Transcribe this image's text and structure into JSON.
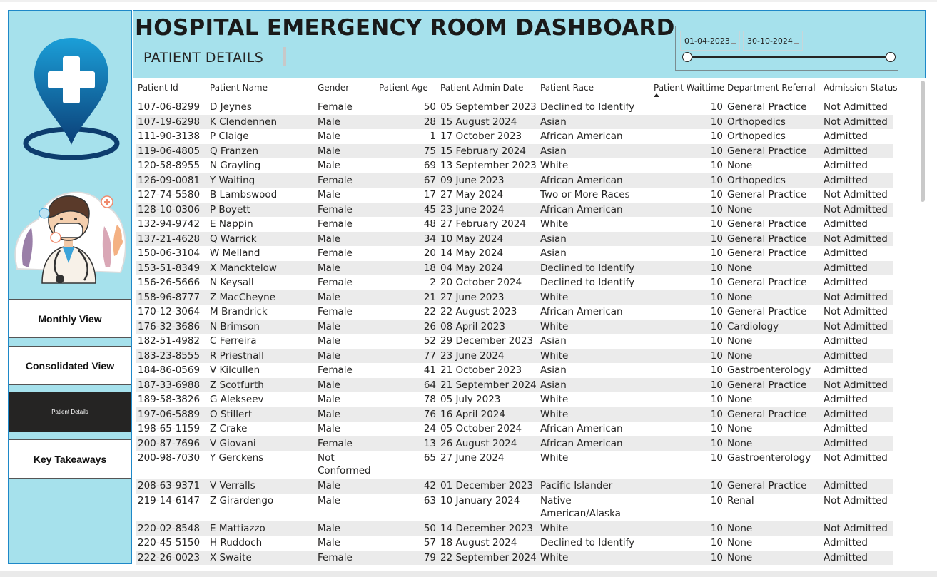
{
  "header": {
    "title": "HOSPITAL EMERGENCY ROOM DASHBOARD",
    "subtitle": "PATIENT DETAILS"
  },
  "date_slicer": {
    "start": "01-04-2023",
    "end": "30-10-2024"
  },
  "nav": {
    "monthly": "Monthly View",
    "consolidated": "Consolidated View",
    "patient_details": "Patient Details",
    "key_takeaways": "Key Takeaways"
  },
  "icons": {
    "location": "hospital-location-pin-icon",
    "doctor": "doctor-illustration-icon",
    "calendar": "calendar-icon"
  },
  "colors": {
    "panel": "#a6e1ec",
    "accent": "#1e88c8",
    "active_nav": "#252423"
  },
  "table": {
    "columns": [
      "Patient Id",
      "Patient Name",
      "Gender",
      "Patient Age",
      "Patient Admin Date",
      "Patient Race",
      "Patient Waittime",
      "Department Referral",
      "Admission Status"
    ],
    "sorted_column": "Patient Waittime",
    "rows": [
      [
        "107-06-8299",
        "D Jeynes",
        "Female",
        "50",
        "05 September 2023",
        "Declined to Identify",
        "10",
        "General Practice",
        "Not Admitted"
      ],
      [
        "107-19-6298",
        "K Clendennen",
        "Male",
        "28",
        "15 August 2024",
        "Asian",
        "10",
        "Orthopedics",
        "Not Admitted"
      ],
      [
        "111-90-3138",
        "P Claige",
        "Male",
        "1",
        "17 October 2023",
        "African American",
        "10",
        "Orthopedics",
        "Admitted"
      ],
      [
        "119-06-4805",
        "Q Franzen",
        "Male",
        "75",
        "15 February 2024",
        "Asian",
        "10",
        "General Practice",
        "Admitted"
      ],
      [
        "120-58-8955",
        "N Grayling",
        "Male",
        "69",
        "13 September 2023",
        "White",
        "10",
        "None",
        "Admitted"
      ],
      [
        "126-09-0081",
        "Y Waiting",
        "Female",
        "67",
        "09 June 2023",
        "African American",
        "10",
        "Orthopedics",
        "Admitted"
      ],
      [
        "127-74-5580",
        "B Lambswood",
        "Male",
        "17",
        "27 May 2024",
        "Two or More Races",
        "10",
        "General Practice",
        "Not Admitted"
      ],
      [
        "128-10-0306",
        "P Boyett",
        "Female",
        "45",
        "23 June 2024",
        "African American",
        "10",
        "None",
        "Not Admitted"
      ],
      [
        "132-94-9742",
        "E Nappin",
        "Female",
        "48",
        "27 February 2024",
        "White",
        "10",
        "General Practice",
        "Admitted"
      ],
      [
        "137-21-4628",
        "Q Warrick",
        "Male",
        "34",
        "10 May 2024",
        "Asian",
        "10",
        "General Practice",
        "Not Admitted"
      ],
      [
        "150-06-3104",
        "W Melland",
        "Female",
        "20",
        "14 May 2024",
        "Asian",
        "10",
        "General Practice",
        "Admitted"
      ],
      [
        "153-51-8349",
        "X Mancktelow",
        "Male",
        "18",
        "04 May 2024",
        "Declined to Identify",
        "10",
        "None",
        "Admitted"
      ],
      [
        "156-26-5666",
        "N Keysall",
        "Female",
        "2",
        "20 October 2024",
        "Declined to Identify",
        "10",
        "General Practice",
        "Admitted"
      ],
      [
        "158-96-8777",
        "Z MacCheyne",
        "Male",
        "21",
        "27 June 2023",
        "White",
        "10",
        "None",
        "Not Admitted"
      ],
      [
        "170-12-3064",
        "M Brandrick",
        "Female",
        "22",
        "22 August 2023",
        "African American",
        "10",
        "General Practice",
        "Not Admitted"
      ],
      [
        "176-32-3686",
        "N Brimson",
        "Male",
        "26",
        "08 April 2023",
        "White",
        "10",
        "Cardiology",
        "Not Admitted"
      ],
      [
        "182-51-4982",
        "C Ferreira",
        "Male",
        "52",
        "29 December 2023",
        "Asian",
        "10",
        "None",
        "Admitted"
      ],
      [
        "183-23-8555",
        "R Priestnall",
        "Male",
        "77",
        "23 June 2024",
        "White",
        "10",
        "None",
        "Admitted"
      ],
      [
        "184-86-0569",
        "V Kilcullen",
        "Female",
        "41",
        "21 October 2023",
        "Asian",
        "10",
        "Gastroenterology",
        "Admitted"
      ],
      [
        "187-33-6988",
        "Z Scotfurth",
        "Male",
        "64",
        "21 September 2024",
        "Asian",
        "10",
        "General Practice",
        "Not Admitted"
      ],
      [
        "189-58-3826",
        "G Alekseev",
        "Male",
        "78",
        "05 July 2023",
        "White",
        "10",
        "None",
        "Admitted"
      ],
      [
        "197-06-5889",
        "O Stillert",
        "Male",
        "76",
        "16 April 2024",
        "White",
        "10",
        "General Practice",
        "Admitted"
      ],
      [
        "198-65-1159",
        "Z Crake",
        "Male",
        "24",
        "05 October 2024",
        "African American",
        "10",
        "None",
        "Admitted"
      ],
      [
        "200-87-7696",
        "V Giovani",
        "Female",
        "13",
        "26 August 2024",
        "African American",
        "10",
        "None",
        "Admitted"
      ],
      [
        "200-98-7030",
        "Y Gerckens",
        "Not Conformed",
        "65",
        "27 June 2024",
        "White",
        "10",
        "Gastroenterology",
        "Not Admitted"
      ],
      [
        "208-63-9371",
        "V Verralls",
        "Male",
        "42",
        "01 December 2023",
        "Pacific Islander",
        "10",
        "General Practice",
        "Admitted"
      ],
      [
        "219-14-6147",
        "Z Girardengo",
        "Male",
        "63",
        "10 January 2024",
        "Native American/Alaska Native",
        "10",
        "Renal",
        "Not Admitted"
      ],
      [
        "220-02-8548",
        "E Mattiazzo",
        "Male",
        "50",
        "14 December 2023",
        "White",
        "10",
        "None",
        "Not Admitted"
      ],
      [
        "220-45-5150",
        "H Ruddoch",
        "Male",
        "57",
        "18 August 2024",
        "Declined to Identify",
        "10",
        "None",
        "Admitted"
      ],
      [
        "222-26-0023",
        "X Swaite",
        "Female",
        "79",
        "22 September 2024",
        "White",
        "10",
        "None",
        "Admitted"
      ]
    ]
  }
}
